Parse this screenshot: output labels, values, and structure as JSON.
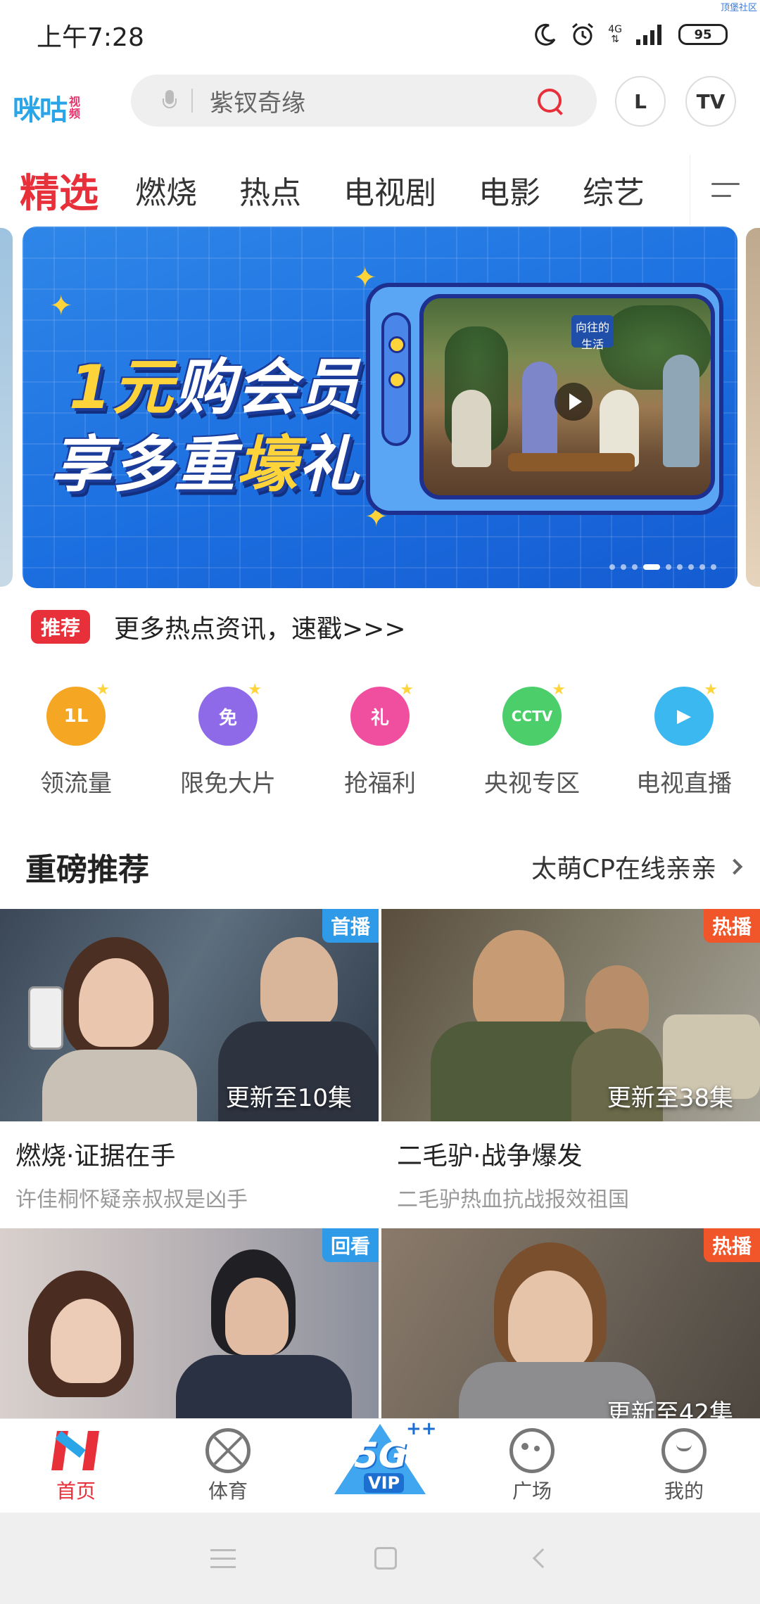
{
  "status_bar": {
    "time": "上午7:28",
    "network": "4G",
    "battery": "95",
    "corner_label": "顶堡社区"
  },
  "header": {
    "logo_main": "咪咕",
    "logo_sub_1": "视",
    "logo_sub_2": "频",
    "search_placeholder": "紫钗奇缘",
    "history_button": "L",
    "tv_button": "TV"
  },
  "tabs": [
    {
      "label": "精选",
      "active": true
    },
    {
      "label": "燃烧"
    },
    {
      "label": "热点"
    },
    {
      "label": "电视剧"
    },
    {
      "label": "电影"
    },
    {
      "label": "综艺"
    }
  ],
  "banner": {
    "line1_pre": "1元",
    "line1_post": "购会员",
    "line2_pre": "享多重",
    "line2_gold": "壕",
    "line2_post": "礼",
    "sign_text_1": "向往的",
    "sign_text_2": "生活",
    "slide_count": 9,
    "active_slide": 4
  },
  "ticker": {
    "badge": "推荐",
    "text": "更多热点资讯，速戳>>>"
  },
  "quick_links": [
    {
      "label": "领流量",
      "icon": "traffic-icon",
      "color": "#f5a623",
      "glyph": "1L"
    },
    {
      "label": "限免大片",
      "icon": "free-movie-icon",
      "color": "#8f6ae8",
      "glyph": "免"
    },
    {
      "label": "抢福利",
      "icon": "gift-icon",
      "color": "#f04fa0",
      "glyph": "礼"
    },
    {
      "label": "央视专区",
      "icon": "cctv-icon",
      "color": "#4ccf6a",
      "glyph": "CCTV"
    },
    {
      "label": "电视直播",
      "icon": "tv-live-icon",
      "color": "#3cb8f0",
      "glyph": "▶"
    }
  ],
  "section": {
    "title": "重磅推荐",
    "more": "太萌CP在线亲亲"
  },
  "cards": [
    {
      "tag": "首播",
      "update": "更新至10集",
      "title": "燃烧·证据在手",
      "subtitle": "许佳桐怀疑亲叔叔是凶手"
    },
    {
      "tag": "热播",
      "update": "更新至38集",
      "title": "二毛驴·战争爆发",
      "subtitle": "二毛驴热血抗战报效祖国"
    },
    {
      "tag": "回看",
      "update": "",
      "title": "",
      "subtitle": ""
    },
    {
      "tag": "热播",
      "update": "更新至42集",
      "title": "",
      "subtitle": ""
    }
  ],
  "bottom_nav": [
    {
      "label": "首页",
      "active": true
    },
    {
      "label": "体育"
    },
    {
      "label": "5G",
      "sub": "VIP",
      "plus": "++"
    },
    {
      "label": "广场"
    },
    {
      "label": "我的"
    }
  ],
  "colors": {
    "accent_red": "#e8303a",
    "brand_blue": "#2aa6e8"
  }
}
